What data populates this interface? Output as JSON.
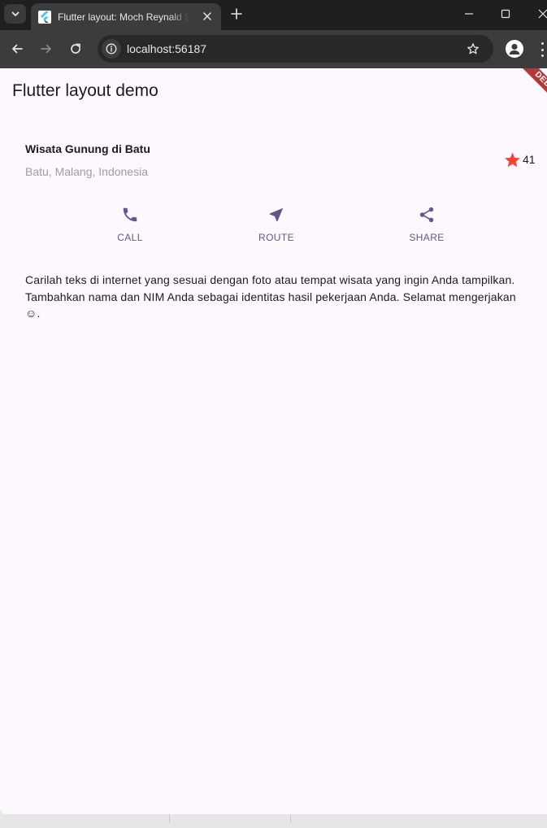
{
  "browser": {
    "tab_title": "Flutter layout: Moch Reynald S",
    "url": "localhost:56187"
  },
  "app": {
    "title": "Flutter layout demo",
    "debug_banner": "DEBUG"
  },
  "place": {
    "name": "Wisata Gunung di Batu",
    "location": "Batu, Malang, Indonesia",
    "rating_count": "41"
  },
  "actions": [
    {
      "label": "CALL",
      "icon": "phone-icon"
    },
    {
      "label": "ROUTE",
      "icon": "navigation-icon"
    },
    {
      "label": "SHARE",
      "icon": "share-icon"
    }
  ],
  "description": "Carilah teks di internet yang sesuai dengan foto atau tempat wisata yang ingin Anda tampilkan. Tambahkan nama dan NIM Anda sebagai identitas hasil pekerjaan Anda. Selamat mengerjakan ☺.",
  "colors": {
    "accent": "#65558f",
    "star": "#f44336",
    "page_background": "#fdf7fe",
    "debug_banner": "#b13b3b"
  }
}
